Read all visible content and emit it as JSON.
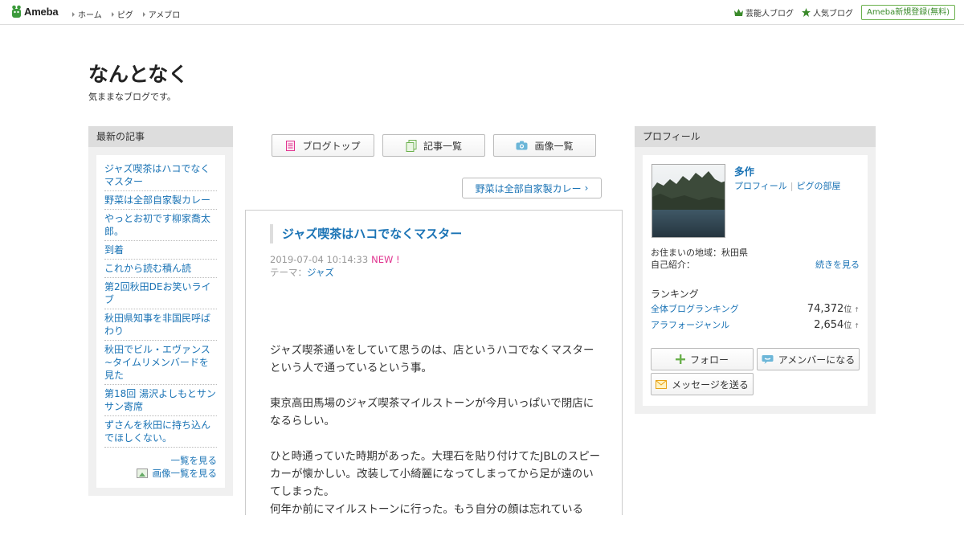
{
  "header": {
    "logo_text": "Ameba",
    "nav": [
      "ホーム",
      "ピグ",
      "アメブロ"
    ],
    "right_links": [
      "芸能人ブログ",
      "人気ブログ"
    ],
    "signup": "Ameba新規登録(無料)"
  },
  "blog": {
    "title": "なんとなく",
    "description": "気ままなブログです。"
  },
  "sidebar": {
    "heading": "最新の記事",
    "items": [
      "ジャズ喫茶はハコでなくマスター",
      "野菜は全部自家製カレー",
      "やっとお初です柳家喬太郎。",
      "到着",
      "これから読む積ん読",
      "第2回秋田DEお笑いライブ",
      "秋田県知事を非国民呼ばわり",
      "秋田でビル・エヴァンス~タイムリメンバードを見た",
      "第18回 湯沢よしもとサンサン寄席",
      "ずさんを秋田に持ち込んでほしくない。"
    ],
    "see_all": "一覧を見る",
    "image_list": "画像一覧を見る"
  },
  "nav_buttons": {
    "blog_top": "ブログトップ",
    "entry_list": "記事一覧",
    "image_list": "画像一覧"
  },
  "next_entry": "野菜は全部自家製カレー",
  "article": {
    "title": "ジャズ喫茶はハコでなくマスター",
    "datetime": "2019-07-04 10:14:33",
    "new_badge": "NEW !",
    "theme_label": "テーマ：",
    "theme": "ジャズ",
    "paragraphs": [
      "ジャズ喫茶通いをしていて思うのは、店というハコでなくマスターという人で通っているという事。",
      "東京高田馬場のジャズ喫茶マイルストーンが今月いっぱいで閉店になるらしい。",
      "ひと時通っていた時期があった。大理石を貼り付けてたJBLのスピーカーが懐かしい。改装して小綺麗になってしまってから足が遠のいてしまった。",
      "何年か前にマイルストーンに行った。もう自分の顔は忘れている"
    ]
  },
  "profile": {
    "heading": "プロフィール",
    "name": "多作",
    "link_profile": "プロフィール",
    "link_pigg": "ピグの部屋",
    "location_label": "お住まいの地域：",
    "location": "秋田県",
    "intro_label": "自己紹介：",
    "intro_more": "続きを見る",
    "ranking_heading": "ランキング",
    "ranking": [
      {
        "label": "全体ブログランキング",
        "value": "74,372",
        "unit": "位",
        "arrow": "↑"
      },
      {
        "label": "アラフォージャンル",
        "value": "2,654",
        "unit": "位",
        "arrow": "↑"
      }
    ],
    "follow": "フォロー",
    "amember": "アメンバーになる",
    "message": "メッセージを送る"
  }
}
